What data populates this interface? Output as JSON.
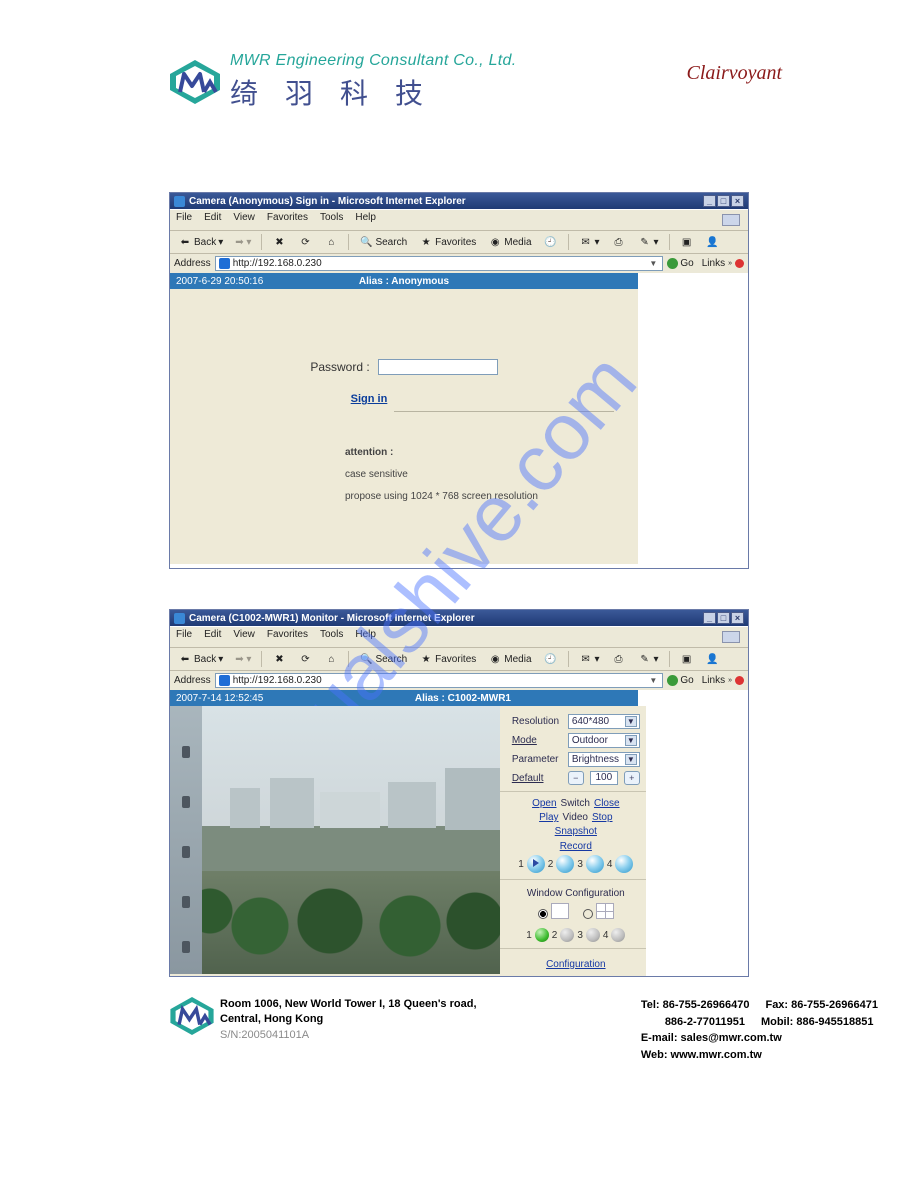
{
  "header": {
    "company_en": "MWR Engineering Consultant Co., Ltd.",
    "company_cn": "绮 羽 科 技",
    "brand_right": "Clairvoyant"
  },
  "ie1": {
    "title": "Camera (Anonymous) Sign in - Microsoft Internet Explorer",
    "menus": [
      "File",
      "Edit",
      "View",
      "Favorites",
      "Tools",
      "Help"
    ],
    "toolbar": {
      "back": "Back",
      "search": "Search",
      "favorites": "Favorites",
      "media": "Media"
    },
    "address_label": "Address",
    "address_url": "http://192.168.0.230",
    "go_label": "Go",
    "links_label": "Links",
    "links_ant": "»",
    "cam_header": {
      "left": "2007-6-29 20:50:16",
      "center": "Alias : Anonymous"
    },
    "login": {
      "password_label": "Password :",
      "signin_label": "Sign in",
      "attention_head": "attention :",
      "line1": "case sensitive",
      "line2": "propose using 1024 * 768 screen resolution"
    }
  },
  "ie2": {
    "title": "Camera (C1002-MWR1) Monitor - Microsoft Internet Explorer",
    "menus": [
      "File",
      "Edit",
      "View",
      "Favorites",
      "Tools",
      "Help"
    ],
    "toolbar": {
      "back": "Back",
      "search": "Search",
      "favorites": "Favorites",
      "media": "Media"
    },
    "address_label": "Address",
    "address_url": "http://192.168.0.230",
    "go_label": "Go",
    "links_label": "Links",
    "links_ant": "»",
    "cam_header": {
      "left": "2007-7-14 12:52:45",
      "center": "Alias : C1002-MWR1"
    },
    "panel": {
      "resolution_label": "Resolution",
      "resolution_value": "640*480",
      "mode_label": "Mode",
      "mode_value": "Outdoor",
      "parameter_label": "Parameter",
      "parameter_value": "Brightness",
      "default_label": "Default",
      "default_value": "100",
      "open": "Open",
      "switch": "Switch",
      "close": "Close",
      "play": "Play",
      "video": "Video",
      "stop": "Stop",
      "snapshot": "Snapshot",
      "record": "Record",
      "rec_nums": [
        "1",
        "2",
        "3",
        "4"
      ],
      "win_config": "Window Configuration",
      "sel_nums": [
        "1",
        "2",
        "3",
        "4"
      ],
      "configuration": "Configuration"
    }
  },
  "footer": {
    "addr_line1": "Room 1006, New World Tower I, 18 Queen's road,",
    "addr_line2": "Central, Hong Kong",
    "sn": "S/N:2005041101A",
    "tel": "Tel: 86-755-26966470",
    "fax": "Fax: 86-755-26966471",
    "tel2": "886-2-77011951",
    "mobil": "Mobil: 886-945518851",
    "email": "E-mail: sales@mwr.com.tw",
    "web": "Web: www.mwr.com.tw"
  },
  "watermark_text": "manualshive.com"
}
